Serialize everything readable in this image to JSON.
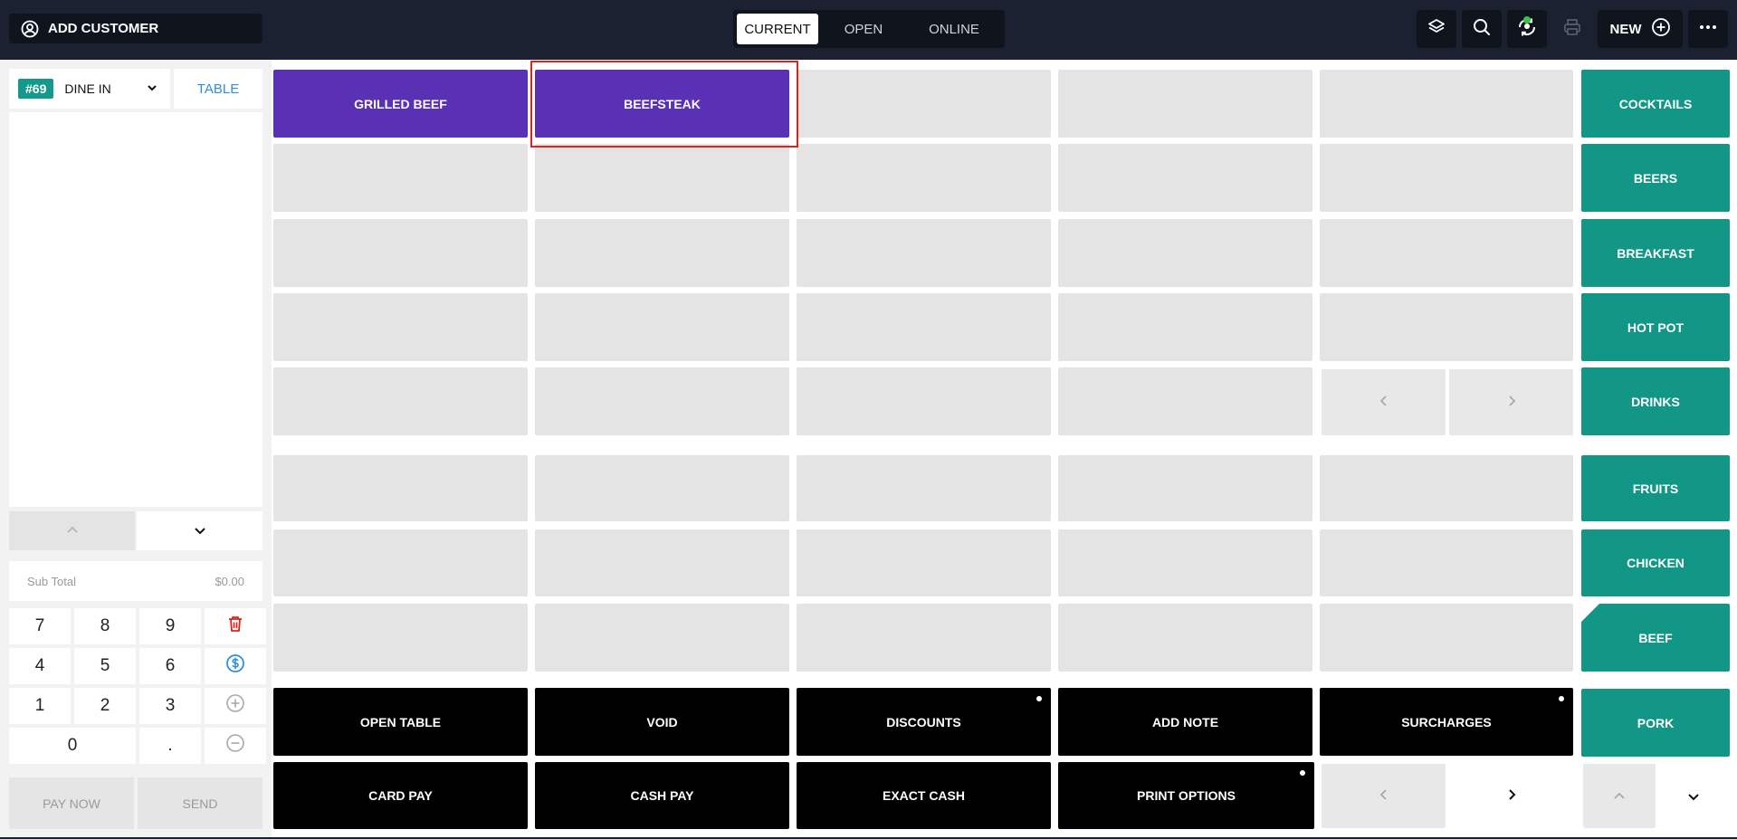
{
  "header": {
    "add_customer_label": "ADD CUSTOMER",
    "tabs": [
      {
        "label": "CURRENT",
        "active": true
      },
      {
        "label": "OPEN",
        "active": false
      },
      {
        "label": "ONLINE",
        "active": false
      }
    ],
    "new_label": "NEW",
    "icons": [
      "layers-icon",
      "search-icon",
      "sync-status-icon",
      "printer-icon",
      "plus-circle-icon",
      "more-icon"
    ]
  },
  "order": {
    "number": "#69",
    "type": "DINE IN",
    "table_label": "TABLE",
    "subtotal_label": "Sub Total",
    "subtotal_value": "$0.00"
  },
  "keypad": {
    "keys": [
      "7",
      "8",
      "9",
      "4",
      "5",
      "6",
      "1",
      "2",
      "3",
      "0",
      "."
    ]
  },
  "actions_left": {
    "pay_now": "PAY NOW",
    "send": "SEND"
  },
  "menu_items": [
    {
      "label": "GRILLED BEEF"
    },
    {
      "label": "BEEFSTEAK",
      "selected": true
    }
  ],
  "categories": [
    {
      "label": "COCKTAILS"
    },
    {
      "label": "BEERS"
    },
    {
      "label": "BREAKFAST"
    },
    {
      "label": "HOT POT"
    },
    {
      "label": "DRINKS"
    },
    {
      "label": "FRUITS"
    },
    {
      "label": "CHICKEN"
    },
    {
      "label": "BEEF",
      "active": true
    },
    {
      "label": "PORK"
    }
  ],
  "function_buttons": [
    {
      "label": "OPEN TABLE"
    },
    {
      "label": "VOID"
    },
    {
      "label": "DISCOUNTS"
    },
    {
      "label": "ADD NOTE"
    },
    {
      "label": "SURCHARGES"
    },
    {
      "label": "CARD PAY"
    },
    {
      "label": "CASH PAY"
    },
    {
      "label": "EXACT CASH"
    },
    {
      "label": "PRINT OPTIONS"
    }
  ],
  "colors": {
    "header_bg": "#1b2130",
    "item_purple": "#5a30b5",
    "category_teal": "#129685",
    "action_black": "#000000",
    "selection_red": "#e0201c",
    "accent_blue": "#2d8fde"
  }
}
